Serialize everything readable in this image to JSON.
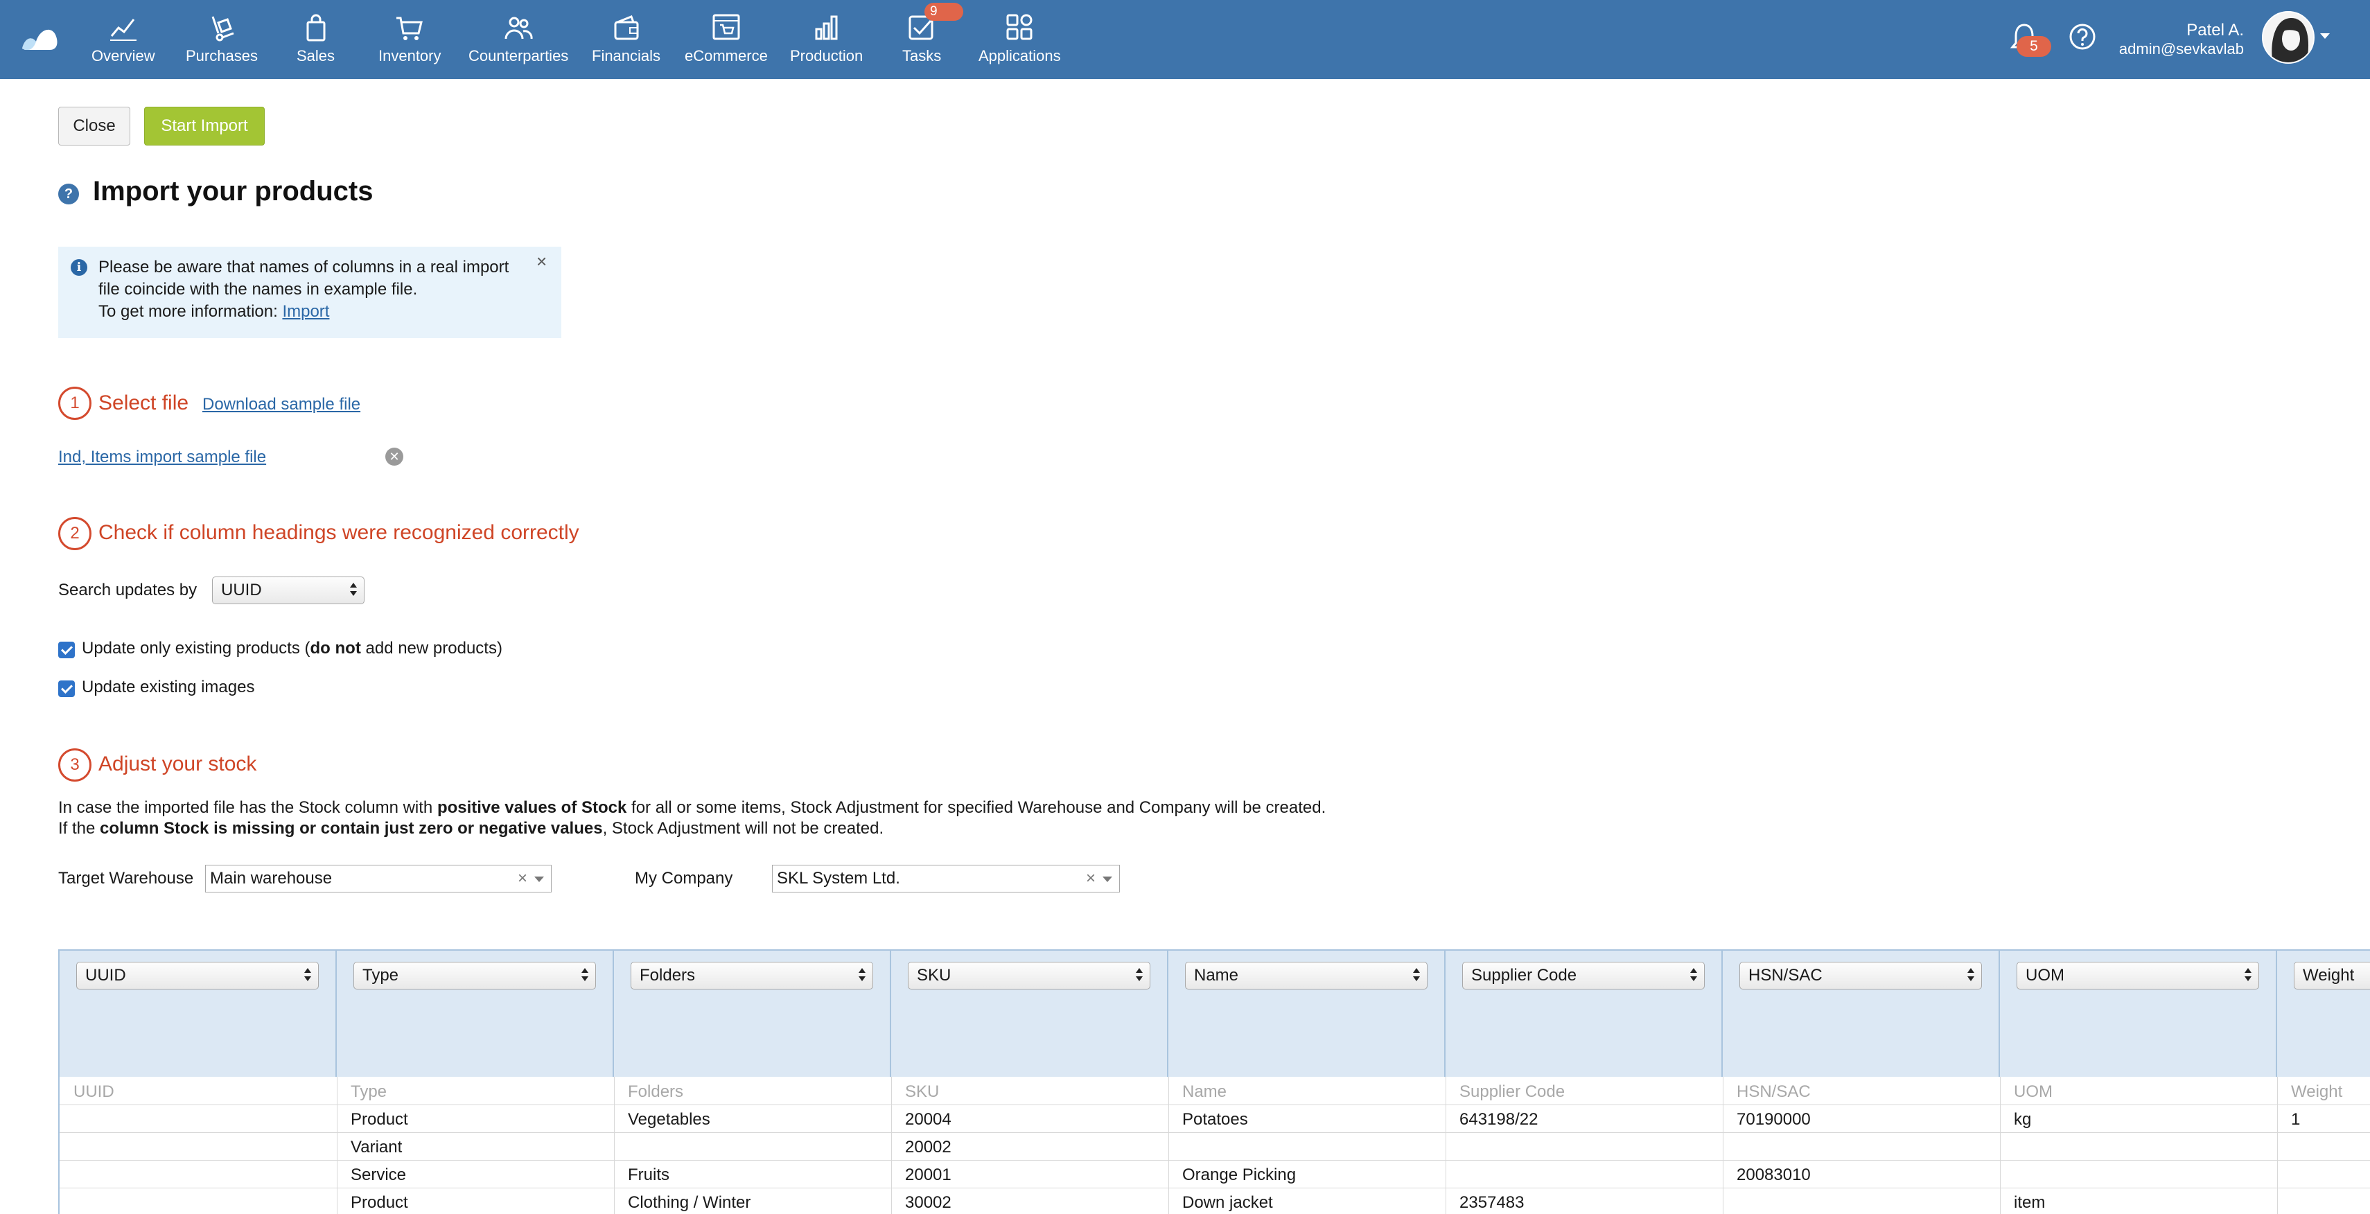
{
  "nav": {
    "items": [
      {
        "label": "Overview",
        "icon": "chart-line-icon"
      },
      {
        "label": "Purchases",
        "icon": "hand-truck-icon"
      },
      {
        "label": "Sales",
        "icon": "shopping-bag-icon"
      },
      {
        "label": "Inventory",
        "icon": "cart-icon"
      },
      {
        "label": "Counterparties",
        "icon": "people-icon"
      },
      {
        "label": "Financials",
        "icon": "wallet-icon"
      },
      {
        "label": "eCommerce",
        "icon": "storefront-icon"
      },
      {
        "label": "Production",
        "icon": "factory-chart-icon"
      },
      {
        "label": "Tasks",
        "icon": "checkbox-icon"
      },
      {
        "label": "Applications",
        "icon": "apps-grid-icon"
      }
    ],
    "tasks_badge": "9",
    "notifications_badge": "5",
    "user_name": "Patel A.",
    "user_email": "admin@sevkavlab",
    "brand_color": "#3e74ab"
  },
  "toolbar": {
    "close_label": "Close",
    "start_import_label": "Start Import"
  },
  "page": {
    "help_glyph": "?",
    "title": "Import your products"
  },
  "info": {
    "line1": "Please be aware that names of columns in a real import",
    "line2": "file coincide with the names in example file.",
    "line3_prefix": "To get more information: ",
    "link": "Import",
    "close_glyph": "×"
  },
  "step1": {
    "number": "1",
    "title": "Select file",
    "download_link": "Download sample file",
    "file_name": "Ind, Items import sample file"
  },
  "step2": {
    "number": "2",
    "title": "Check if column headings were recognized correctly",
    "search_label": "Search updates by",
    "search_value": "UUID",
    "checkbox1_pre": "Update only existing products (",
    "checkbox1_bold": "do not",
    "checkbox1_post": " add new products)",
    "checkbox1_checked": true,
    "checkbox2_label": "Update existing images",
    "checkbox2_checked": true
  },
  "step3": {
    "number": "3",
    "title": "Adjust your stock",
    "p1_a": "In case the imported file has the Stock column with ",
    "p1_b": "positive values of Stock",
    "p1_c": " for all or some items, Stock Adjustment for specified Warehouse and Company will be created.",
    "p2_a": "If the ",
    "p2_b": "column Stock is missing or contain just zero or negative values",
    "p2_c": ", Stock Adjustment will not be created.",
    "warehouse_label": "Target Warehouse",
    "warehouse_value": "Main warehouse",
    "company_label": "My Company",
    "company_value": "SKL System Ltd."
  },
  "mapping": {
    "columns": [
      "UUID",
      "Type",
      "Folders",
      "SKU",
      "Name",
      "Supplier Code",
      "HSN/SAC",
      "UOM",
      "Weight"
    ],
    "header_row": [
      "UUID",
      "Type",
      "Folders",
      "SKU",
      "Name",
      "Supplier Code",
      "HSN/SAC",
      "UOM",
      "Weight"
    ],
    "rows": [
      [
        "",
        "Product",
        "Vegetables",
        "20004",
        "Potatoes",
        "643198/22",
        "70190000",
        "kg",
        "1"
      ],
      [
        "",
        "Variant",
        "",
        "20002",
        "",
        "",
        "",
        "",
        ""
      ],
      [
        "",
        "Service",
        "Fruits",
        "20001",
        "Orange Picking",
        "",
        "20083010",
        "",
        ""
      ],
      [
        "",
        "Product",
        "Clothing / Winter",
        "30002",
        "Down jacket",
        "2357483",
        "",
        "item",
        ""
      ]
    ]
  }
}
